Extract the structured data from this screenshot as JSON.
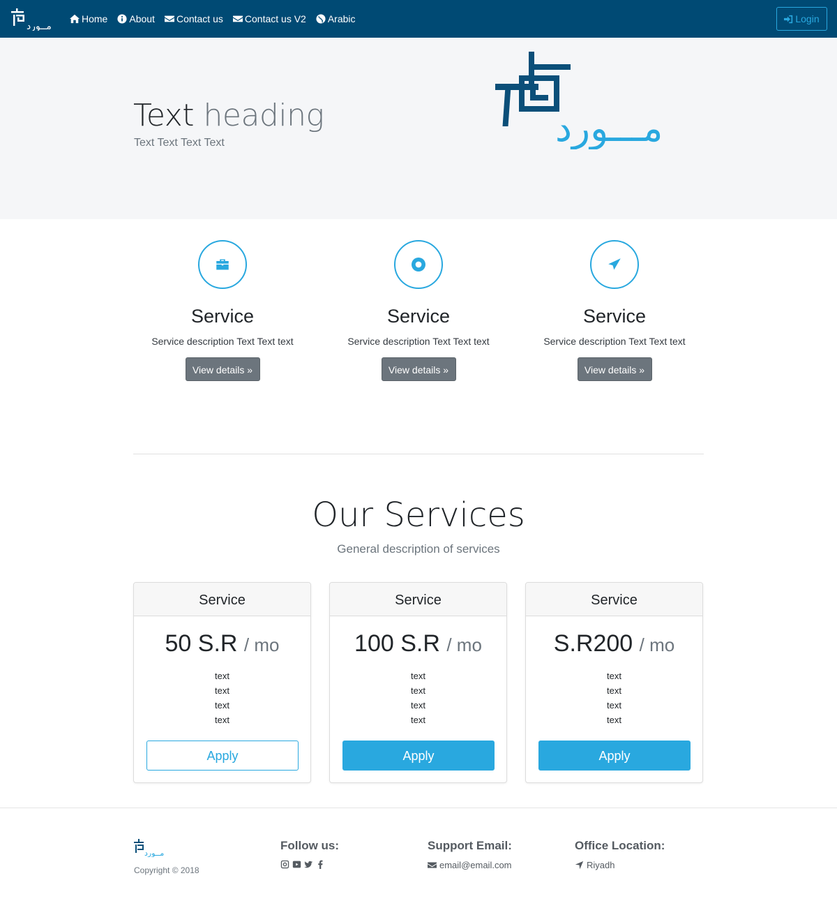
{
  "nav": {
    "items": [
      {
        "label": "Home",
        "icon": "home-icon"
      },
      {
        "label": "About",
        "icon": "info-icon"
      },
      {
        "label": "Contact us",
        "icon": "envelope-icon"
      },
      {
        "label": "Contact us V2",
        "icon": "envelope-icon"
      },
      {
        "label": "Arabic",
        "icon": "globe-icon"
      }
    ],
    "login_label": "Login"
  },
  "hero": {
    "title_main": "Text",
    "title_muted": "heading",
    "subtitle": "Text Text Text Text"
  },
  "features": [
    {
      "icon": "briefcase-icon",
      "title": "Service",
      "description": "Service description Text Text text",
      "button": "View details »"
    },
    {
      "icon": "life-ring-icon",
      "title": "Service",
      "description": "Service description Text Text text",
      "button": "View details »"
    },
    {
      "icon": "paper-plane-icon",
      "title": "Service",
      "description": "Service description Text Text text",
      "button": "View details »"
    }
  ],
  "pricing": {
    "title": "Our Services",
    "subtitle": "General description of services",
    "cards": [
      {
        "header": "Service",
        "price": "50 S.R",
        "period": "/ mo",
        "items": [
          "text",
          "text",
          "text",
          "text"
        ],
        "button": "Apply",
        "style": "outline"
      },
      {
        "header": "Service",
        "price": "100 S.R",
        "period": "/ mo",
        "items": [
          "text",
          "text",
          "text",
          "text"
        ],
        "button": "Apply",
        "style": "solid"
      },
      {
        "header": "Service",
        "price": "S.R200",
        "period": "/ mo",
        "items": [
          "text",
          "text",
          "text",
          "text"
        ],
        "button": "Apply",
        "style": "solid"
      }
    ]
  },
  "footer": {
    "copyright": "Copyright © 2018",
    "follow_title": "Follow us:",
    "social_icons": [
      "instagram-icon",
      "youtube-icon",
      "twitter-icon",
      "facebook-icon"
    ],
    "support_title": "Support Email:",
    "support_email": "email@email.com",
    "office_title": "Office Location:",
    "office_location": "Riyadh"
  },
  "colors": {
    "navbar": "#004a74",
    "accent": "#29a8df",
    "hero_bg": "#f5f6f8",
    "secondary_button": "#6c757d"
  }
}
